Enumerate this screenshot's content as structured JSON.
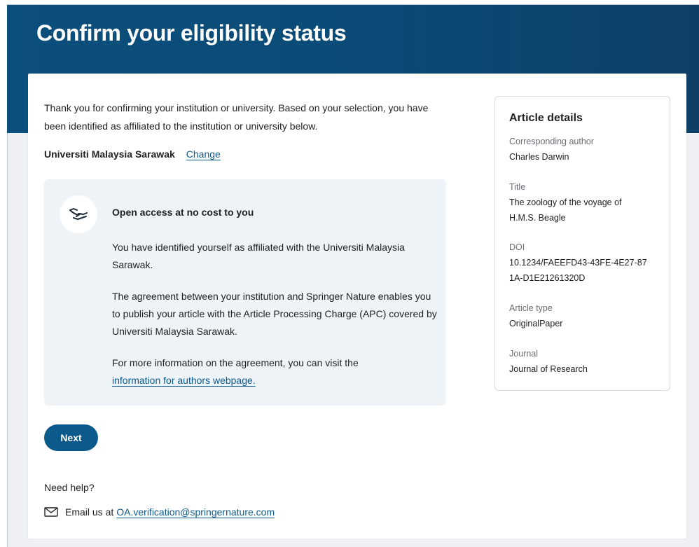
{
  "header": {
    "title": "Confirm your eligibility status"
  },
  "main": {
    "intro": "Thank you for confirming your institution or university. Based on your selection, you have been identified as affiliated to the institution or university below.",
    "institution": "Universiti Malaysia Sarawak",
    "change_link": "Change",
    "info_box": {
      "icon": "handshake-icon",
      "title": "Open access at no cost to you",
      "para1": "You have identified yourself as affiliated with the Universiti Malaysia Sarawak.",
      "para2": "The agreement between your institution and Springer Nature enables you to publish your article with the Article Processing Charge (APC) covered by Universiti Malaysia Sarawak.",
      "para3_prefix": "For more information on the agreement, you can visit the",
      "para3_link": "information for authors webpage."
    },
    "next_button": "Next",
    "help": {
      "heading": "Need help?",
      "icon": "mail-icon",
      "email_prefix": "Email us at",
      "email": "OA.verification@springernature.com"
    }
  },
  "article_details": {
    "title": "Article details",
    "fields": [
      {
        "label": "Corresponding author",
        "value": "Charles Darwin"
      },
      {
        "label": "Title",
        "value": "The zoology of the voyage of H.M.S. Beagle"
      },
      {
        "label": "DOI",
        "value": "10.1234/FAEEFD43-43FE-4E27-871A-D1E21261320D"
      },
      {
        "label": "Article type",
        "value": "OriginalPaper"
      },
      {
        "label": "Journal",
        "value": "Journal of Research"
      }
    ]
  },
  "colors": {
    "header_bg": "#0b4f7c",
    "accent": "#0c5a8c",
    "info_box_bg": "#eef3f8"
  }
}
